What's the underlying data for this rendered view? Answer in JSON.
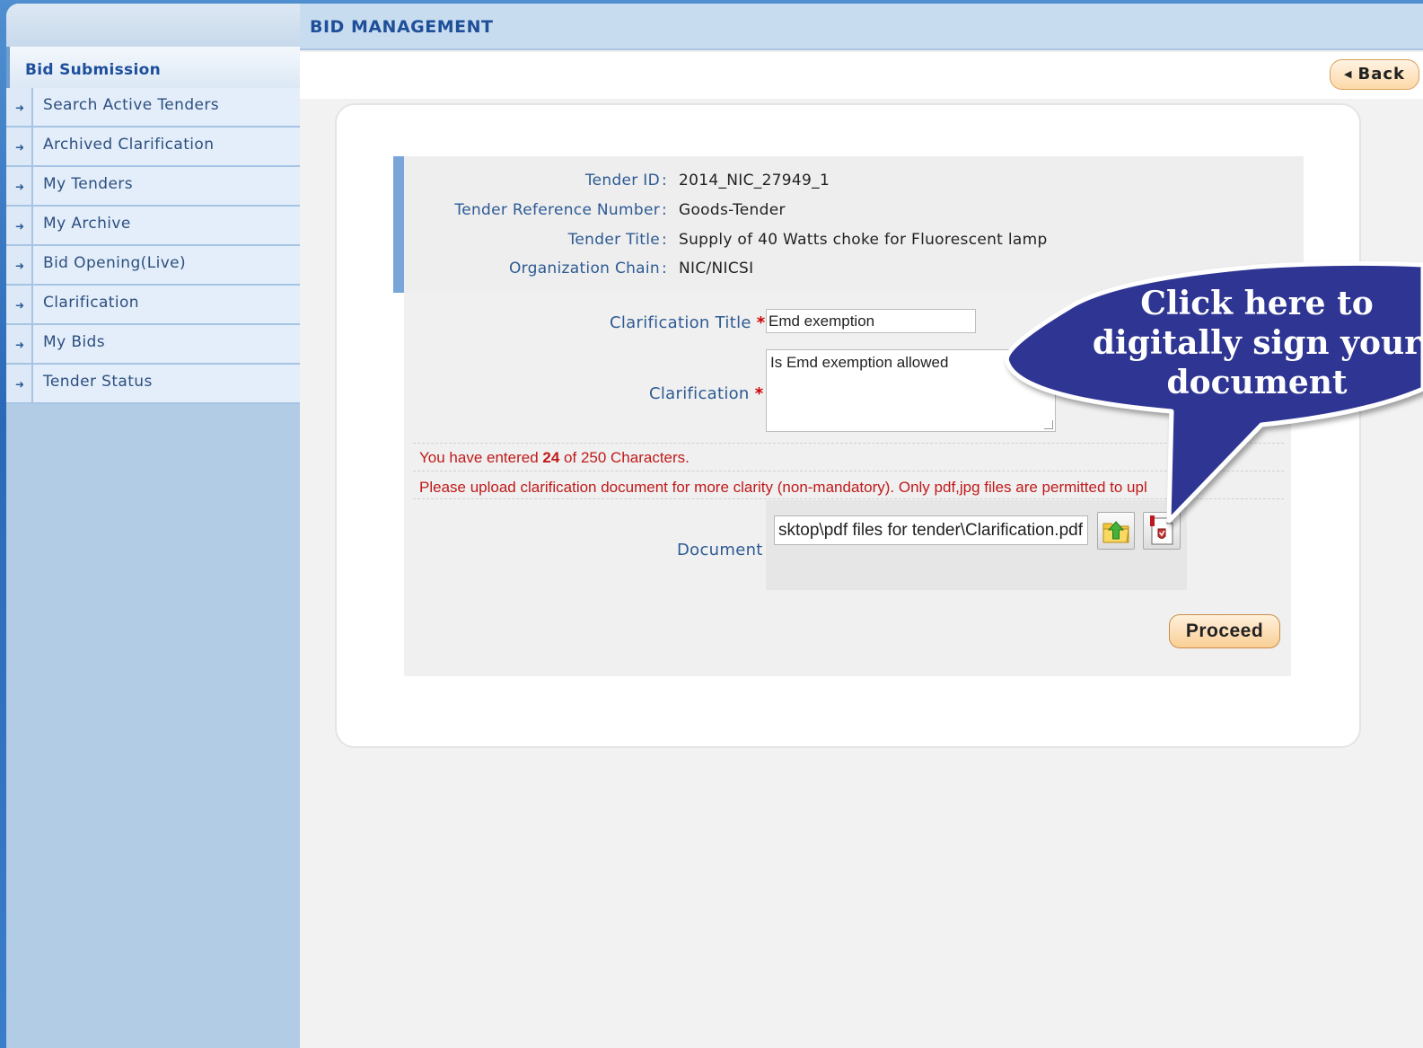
{
  "header": {
    "title": "BID MANAGEMENT",
    "back_label": "Back"
  },
  "sidebar": {
    "title": "Bid Submission",
    "items": [
      {
        "label": "Search Active Tenders"
      },
      {
        "label": "Archived Clarification"
      },
      {
        "label": "My Tenders"
      },
      {
        "label": "My Archive"
      },
      {
        "label": "Bid Opening(Live)"
      },
      {
        "label": "Clarification"
      },
      {
        "label": "My Bids"
      },
      {
        "label": "Tender Status"
      }
    ]
  },
  "tender_info": {
    "tender_id_label": "Tender ID",
    "tender_id": "2014_NIC_27949_1",
    "ref_label": "Tender Reference Number",
    "ref": "Goods-Tender",
    "title_label": "Tender Title",
    "title": "Supply of 40 Watts choke for Fluorescent lamp",
    "org_label": "Organization Chain",
    "org": "NIC/NICSI",
    "separator": ":"
  },
  "form": {
    "clarification_title_label": "Clarification Title",
    "clarification_title_value": "Emd exemption",
    "clarification_label": "Clarification",
    "clarification_value": "Is Emd exemption allowed",
    "required_mark": "*",
    "char_count_prefix": "You have entered",
    "char_count": "24",
    "char_count_suffix": "of 250 Characters.",
    "upload_note": "Please upload clarification document for more clarity (non-mandatory). Only pdf,jpg files are permitted to upl",
    "document_label": "Document",
    "document_value": "sktop\\pdf files for tender\\Clarification.pdf",
    "proceed_label": "Proceed"
  },
  "callout": {
    "line1": "Click here to",
    "line2": "digitally sign your",
    "line3": "document",
    "fill_color": "#2e3592"
  },
  "icons": {
    "menu_arrow": "arrow-right-icon",
    "upload": "upload-folder-icon",
    "sign": "digital-sign-icon",
    "back": "triangle-left-icon"
  }
}
